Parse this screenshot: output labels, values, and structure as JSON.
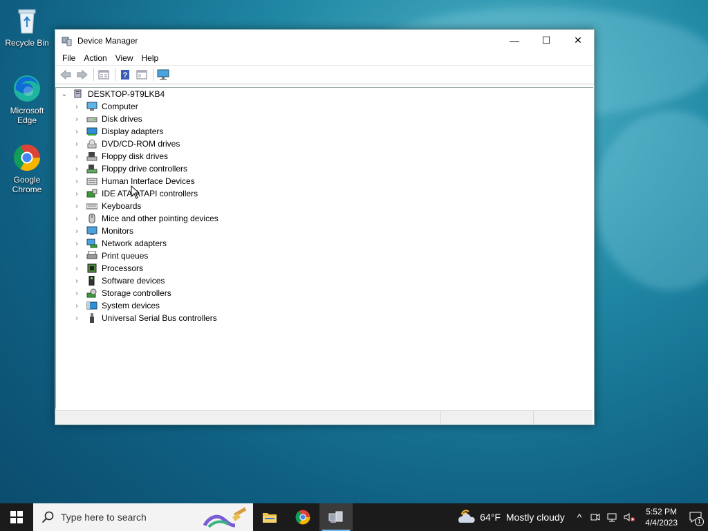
{
  "desktop": {
    "icons": [
      {
        "label": "Recycle Bin"
      },
      {
        "label": "Microsoft Edge"
      },
      {
        "label": "Google Chrome"
      }
    ]
  },
  "window": {
    "title": "Device Manager",
    "controls": {
      "minimize": "—",
      "maximize": "☐",
      "close": "✕"
    },
    "menu": [
      "File",
      "Action",
      "View",
      "Help"
    ],
    "toolbar_icons": [
      "back-icon",
      "forward-icon",
      "properties-icon",
      "help-icon",
      "view-icon",
      "monitor-scan-icon"
    ],
    "tree": {
      "root": "DESKTOP-9T9LKB4",
      "items": [
        {
          "label": "Computer",
          "icon": "computer-icon"
        },
        {
          "label": "Disk drives",
          "icon": "disk-drive-icon"
        },
        {
          "label": "Display adapters",
          "icon": "display-adapter-icon"
        },
        {
          "label": "DVD/CD-ROM drives",
          "icon": "dvd-icon"
        },
        {
          "label": "Floppy disk drives",
          "icon": "floppy-disk-icon"
        },
        {
          "label": "Floppy drive controllers",
          "icon": "floppy-controller-icon"
        },
        {
          "label": "Human Interface Devices",
          "icon": "hid-icon"
        },
        {
          "label": "IDE ATA/ATAPI controllers",
          "icon": "ide-controller-icon"
        },
        {
          "label": "Keyboards",
          "icon": "keyboard-icon"
        },
        {
          "label": "Mice and other pointing devices",
          "icon": "mouse-icon"
        },
        {
          "label": "Monitors",
          "icon": "monitor-icon"
        },
        {
          "label": "Network adapters",
          "icon": "network-adapter-icon"
        },
        {
          "label": "Print queues",
          "icon": "printer-icon"
        },
        {
          "label": "Processors",
          "icon": "processor-icon"
        },
        {
          "label": "Software devices",
          "icon": "software-device-icon"
        },
        {
          "label": "Storage controllers",
          "icon": "storage-controller-icon"
        },
        {
          "label": "System devices",
          "icon": "system-device-icon"
        },
        {
          "label": "Universal Serial Bus controllers",
          "icon": "usb-icon"
        }
      ]
    }
  },
  "taskbar": {
    "search_placeholder": "Type here to search",
    "weather": {
      "temp": "64°F",
      "condition": "Mostly cloudy"
    },
    "clock": {
      "time": "5:52 PM",
      "date": "4/4/2023"
    },
    "notification_count": "1",
    "tray_expand": "^"
  },
  "colors": {
    "taskbar_bg": "#1b1b1b",
    "active_indicator": "#76b9ed",
    "desktop_bg": "#1f86a3"
  }
}
